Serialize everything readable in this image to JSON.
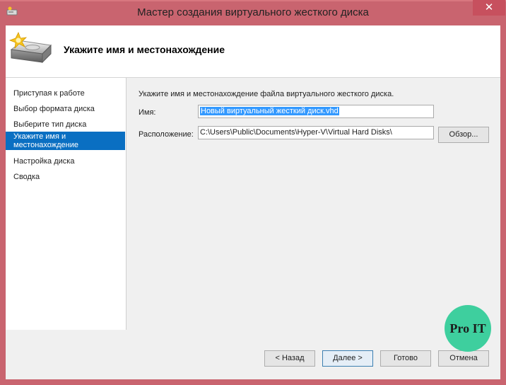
{
  "window": {
    "title": "Мастер создания виртуального жесткого диска",
    "close_glyph": "✕"
  },
  "header": {
    "title": "Укажите имя и местонахождение",
    "icon": "hard-disk-wizard-icon"
  },
  "steps": [
    {
      "label": "Приступая к работе"
    },
    {
      "label": "Выбор формата диска"
    },
    {
      "label": "Выберите тип диска"
    },
    {
      "label": "Укажите имя и местонахождение",
      "active": true
    },
    {
      "label": "Настройка диска"
    },
    {
      "label": "Сводка"
    }
  ],
  "form": {
    "description": "Укажите имя и местонахождение файла виртуального жесткого диска.",
    "name_label": "Имя:",
    "name_value": "Новый виртуальный жесткий диск.vhd",
    "location_label": "Расположение:",
    "location_value": "C:\\Users\\Public\\Documents\\Hyper-V\\Virtual Hard Disks\\",
    "browse_label": "Обзор..."
  },
  "buttons": {
    "back": "< Назад",
    "next": "Далее >",
    "finish": "Готово",
    "cancel": "Отмена"
  },
  "watermark": "Pro IT",
  "colors": {
    "frame": "#c9646f",
    "selection": "#0a6fc2",
    "badge": "#3ecf9e"
  }
}
